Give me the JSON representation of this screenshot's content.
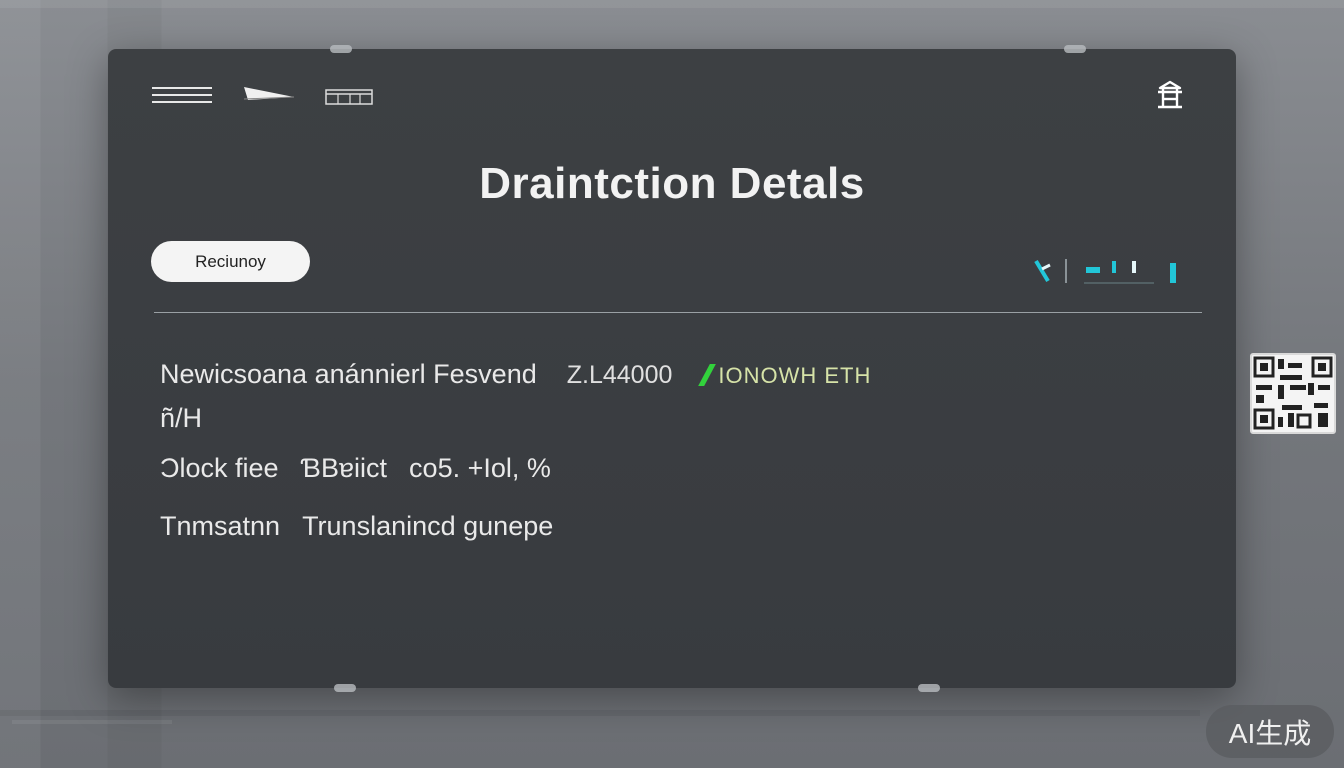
{
  "header": {
    "title": "Draintction Detals",
    "icons": [
      "menu-icon",
      "logo-icon",
      "card-icon",
      "user-icon"
    ]
  },
  "pill": {
    "label": "Reciunoy"
  },
  "details": {
    "row1": {
      "label": "Newicsoana anánnierl Fesvend",
      "label_wrap": "ñ/H",
      "amount": "Z.L44000",
      "status": "IONOWH ETH"
    },
    "row2": {
      "label": "Ɔlock fiee",
      "sublabel": "ƁBɐiict",
      "value": "co5. +Iol, %"
    },
    "row3": {
      "label": "Tnmsatnn",
      "value": "Trunslanincd ɡunepe"
    }
  },
  "watermark": {
    "text": "AI生成"
  },
  "colors": {
    "card": "#3b3e42",
    "accent_cyan": "#22c6d8",
    "status_green": "#32d23c",
    "status_text": "#d6e3a8"
  }
}
